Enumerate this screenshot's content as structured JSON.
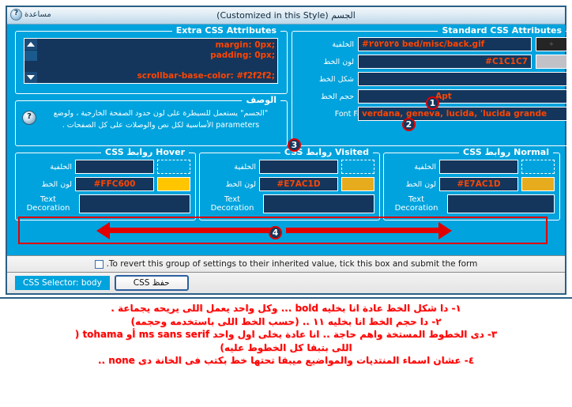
{
  "window": {
    "title": "الجسم (Customized in this Style)",
    "help_label": "مساعدة",
    "help_icon": "question-mark-icon"
  },
  "extra_css": {
    "legend": "Extra CSS Attributes",
    "textarea_lines": [
      "margin: 0px;",
      "padding: 0px;",
      "",
      "scrollbar-base-color: #f2f2f2;"
    ],
    "scroll_up_icon": "triangle-up-icon",
    "scroll_down_icon": "triangle-down-icon"
  },
  "description": {
    "legend": "الوصف",
    "icon": "question-mark-icon",
    "line1": "\"الجسم\" يستعمل للسيطرة على لون حدود الصفحة الخارجية ، ولوضع",
    "line2": "parameters الأساسية لكل نص والوصلات على كل الصفحات ."
  },
  "standard_css": {
    "legend": "Standard CSS Attributes",
    "rows": [
      {
        "label": "الخلفية",
        "value": "#٢٥٢٥٢٥ bed/misc/back.gif",
        "swatch": "#252525",
        "swatch_type": "solid",
        "swatch_glyph": "+"
      },
      {
        "label": "لون الخط",
        "value": "#C1C1C7",
        "swatch": "#C1C1C7",
        "swatch_type": "solid",
        "swatch_glyph": ""
      },
      {
        "label": "شكل الخط",
        "value": "",
        "swatch": "",
        "swatch_type": "none",
        "swatch_glyph": ""
      },
      {
        "label": "حجم الخط",
        "value": "Apt",
        "swatch": "",
        "swatch_type": "none",
        "swatch_glyph": ""
      },
      {
        "label": "Font Family",
        "value": "verdana, geneva, lucida, 'lucida grande",
        "swatch": "",
        "swatch_type": "none",
        "swatch_glyph": ""
      }
    ]
  },
  "link_groups": [
    {
      "legend": "Hover روابط CSS",
      "bg_label": "الخلفية",
      "bg_value": "",
      "color_label": "لون الخط",
      "color_value": "#FFC600",
      "color_swatch": "#FFC600",
      "td_label_line1": "Text",
      "td_label_line2": "Decoration",
      "td_value": ""
    },
    {
      "legend": "Visited روابط CSS",
      "bg_label": "الخلفية",
      "bg_value": "",
      "color_label": "لون الخط",
      "color_value": "#E7AC1D",
      "color_swatch": "#E7AC1D",
      "td_label_line1": "Text",
      "td_label_line2": "Decoration",
      "td_value": ""
    },
    {
      "legend": "Normal روابط CSS",
      "bg_label": "الخلفية",
      "bg_value": "",
      "color_label": "لون الخط",
      "color_value": "#E7AC1D",
      "color_swatch": "#E7AC1D",
      "td_label_line1": "Text",
      "td_label_line2": "Decoration",
      "td_value": ""
    }
  ],
  "revert": {
    "label": ".To revert this group of settings to their inherited value, tick this box and submit the form",
    "checked": false
  },
  "buttons": {
    "save": "حفظ CSS",
    "selector": "CSS Selector: body"
  },
  "markers": [
    "1",
    "2",
    "3",
    "4"
  ],
  "notes": [
    "١- دا شكل الخط عادة انا بخليه bold ... وكل واحد يعمل اللى يريحه يجماعة .",
    "٢- دا حجم الخط انا بخليه ١١ .. (حسب الخط اللى باستخدمه وحجمه)",
    "٣- دى الخطوط المستخة واهم حاجة .. انا عادة بخلى اول واحد ms sans serif أو tohama (",
    "اللى بتبقا كل الخطوط عليه)",
    "٤- عشان اسماء المنتديات والمواضيع ميبقا تحتها خط بكتب فى الخانة دى none .."
  ],
  "colors": {
    "window_blue": "#00A3DD",
    "field_navy": "#14365c",
    "orange_text": "#FF4500",
    "annotation_red": "#E00000",
    "note_red": "#FF0000"
  }
}
